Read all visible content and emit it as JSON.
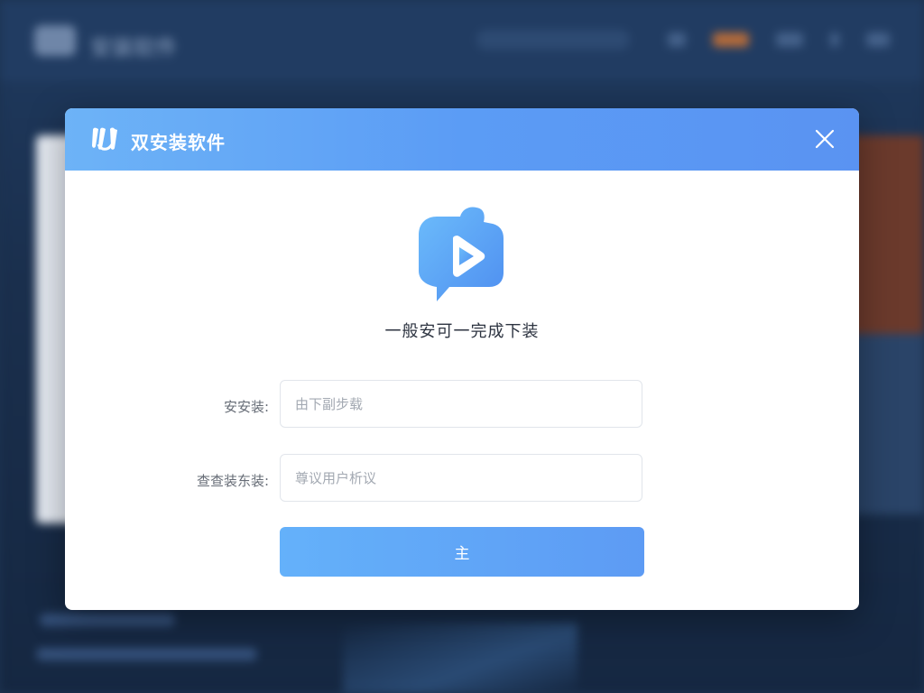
{
  "background": {
    "brand": "安装软件"
  },
  "dialog": {
    "title": "双安装软件",
    "close_icon": "close-icon",
    "logo_icon": "app-logo-icon",
    "app_icon": "play-chat-bubble-icon",
    "subtitle": "一般安可一完成下装",
    "fields": [
      {
        "label": "安安装:",
        "placeholder": "由下副步载"
      },
      {
        "label": "查查装东装:",
        "placeholder": "尊议用户析议"
      }
    ],
    "submit_label": "主"
  },
  "colors": {
    "header_gradient_start": "#6db3f7",
    "header_gradient_end": "#5a93f2",
    "button_gradient_start": "#64b1fa",
    "button_gradient_end": "#5d9bf4",
    "background": "#1d3350"
  }
}
